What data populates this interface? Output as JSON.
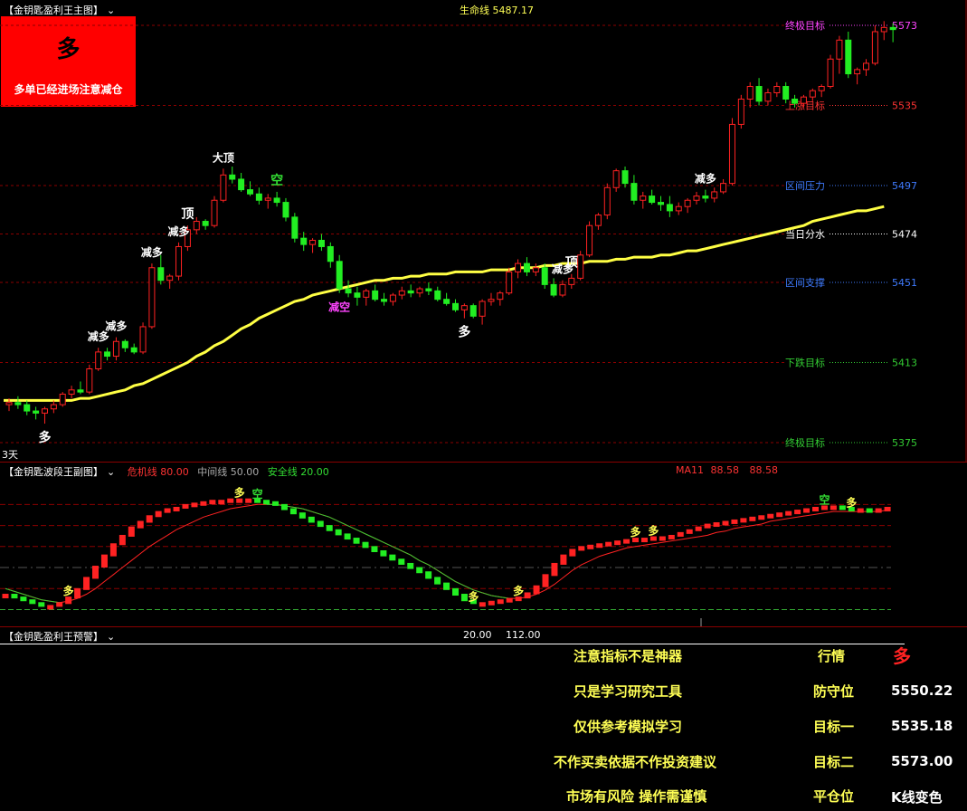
{
  "main": {
    "title": "【金钥匙盈利王主图】",
    "lifeline_label": "生命线",
    "lifeline_value": "5487.17",
    "signal_box": {
      "big": "多",
      "text": "多单已经进场注意减仓"
    },
    "period_label": "3天",
    "levels": [
      {
        "label": "终极目标",
        "value": "5573",
        "color": "#ff44ff",
        "level": 5573
      },
      {
        "label": "上涨目标",
        "value": "5535",
        "color": "#ff3333",
        "level": 5535
      },
      {
        "label": "区间压力",
        "value": "5497",
        "color": "#3f7bff",
        "level": 5497
      },
      {
        "label": "当日分水",
        "value": "5474",
        "color": "#ffffff",
        "level": 5474
      },
      {
        "label": "区间支撑",
        "value": "5451",
        "color": "#3f7bff",
        "level": 5451
      },
      {
        "label": "下跌目标",
        "value": "5413",
        "color": "#33cc33",
        "level": 5413
      },
      {
        "label": "终极目标",
        "value": "5375",
        "color": "#33cc33",
        "level": 5375
      }
    ],
    "markers": [
      {
        "text": "多",
        "i": 4,
        "pos": "below",
        "color": "#ffffff"
      },
      {
        "text": "减多",
        "i": 10,
        "pos": "above",
        "color": "#ffffff"
      },
      {
        "text": "减多",
        "i": 12,
        "pos": "above",
        "color": "#ffffff"
      },
      {
        "text": "减多",
        "i": 16,
        "pos": "above",
        "color": "#ffffff"
      },
      {
        "text": "减多",
        "i": 19,
        "pos": "above",
        "color": "#ffffff"
      },
      {
        "text": "顶",
        "i": 20,
        "pos": "above",
        "color": "#ffffff"
      },
      {
        "text": "大顶",
        "i": 24,
        "pos": "above",
        "color": "#ffffff"
      },
      {
        "text": "空",
        "i": 30,
        "pos": "above",
        "color": "#33dd33"
      },
      {
        "text": "减空",
        "i": 37,
        "pos": "below",
        "color": "#ff44ff"
      },
      {
        "text": "多",
        "i": 51,
        "pos": "below",
        "color": "#ffffff"
      },
      {
        "text": "减多",
        "i": 62,
        "pos": "above",
        "color": "#ffffff"
      },
      {
        "text": "顶",
        "i": 63,
        "pos": "above",
        "color": "#ffffff"
      },
      {
        "text": "减多",
        "i": 78,
        "pos": "above",
        "color": "#ffffff"
      }
    ]
  },
  "sub": {
    "title": "【金钥匙波段王副图】",
    "danger_label": "危机线",
    "danger_value": "80.00",
    "mid_label": "中间线",
    "mid_value": "50.00",
    "safe_label": "安全线",
    "safe_value": "20.00",
    "ma_label": "MA11",
    "ma_value1": "88.58",
    "ma_value2": "88.58",
    "markers": [
      {
        "text": "多",
        "i": 7,
        "color": "#ffff55"
      },
      {
        "text": "多",
        "i": 26,
        "color": "#ffff55"
      },
      {
        "text": "空",
        "i": 28,
        "color": "#33dd33"
      },
      {
        "text": "多",
        "i": 52,
        "color": "#ffff55"
      },
      {
        "text": "多",
        "i": 57,
        "color": "#ffff55"
      },
      {
        "text": "多",
        "i": 70,
        "color": "#ffff55"
      },
      {
        "text": "多",
        "i": 72,
        "color": "#ffff55"
      },
      {
        "text": "空",
        "i": 91,
        "color": "#33dd33"
      },
      {
        "text": "多",
        "i": 94,
        "color": "#ffff55"
      }
    ]
  },
  "warn": {
    "title": "【金钥匙盈利王预警】",
    "val1": "20.00",
    "val2": "112.00",
    "rows": [
      {
        "left": "注意指标不是神器",
        "key": "行情",
        "value": "多"
      },
      {
        "left": "只是学习研究工具",
        "key": "防守位",
        "value": "5550.22"
      },
      {
        "left": "仅供参考模拟学习",
        "key": "目标一",
        "value": "5535.18"
      },
      {
        "left": "不作买卖依据不作投资建议",
        "key": "目标二",
        "value": "5573.00"
      },
      {
        "left": "市场有风险 操作需谨慎",
        "key": "平仓位",
        "value": "K线变色"
      }
    ]
  },
  "colors": {
    "up": "#ff2222",
    "down": "#22ee22",
    "lifeline": "#ffff44",
    "bg": "#000000",
    "panel_border": "#8b0000"
  },
  "chart_data": {
    "type": "candlestick",
    "title": "金钥匙盈利王主图",
    "ylim": [
      5360,
      5585
    ],
    "candles": [
      [
        5393,
        5396,
        5390,
        5394
      ],
      [
        5394,
        5397,
        5391,
        5393
      ],
      [
        5393,
        5395,
        5388,
        5390
      ],
      [
        5390,
        5392,
        5386,
        5389
      ],
      [
        5389,
        5392,
        5384,
        5391
      ],
      [
        5391,
        5395,
        5389,
        5393
      ],
      [
        5393,
        5399,
        5392,
        5398
      ],
      [
        5398,
        5402,
        5396,
        5400
      ],
      [
        5400,
        5404,
        5398,
        5399
      ],
      [
        5399,
        5412,
        5398,
        5410
      ],
      [
        5410,
        5420,
        5409,
        5418
      ],
      [
        5418,
        5420,
        5414,
        5416
      ],
      [
        5416,
        5425,
        5414,
        5423
      ],
      [
        5423,
        5424,
        5418,
        5420
      ],
      [
        5420,
        5422,
        5417,
        5418
      ],
      [
        5418,
        5432,
        5417,
        5430
      ],
      [
        5430,
        5460,
        5429,
        5458
      ],
      [
        5458,
        5464,
        5450,
        5452
      ],
      [
        5452,
        5455,
        5448,
        5454
      ],
      [
        5454,
        5470,
        5452,
        5468
      ],
      [
        5468,
        5478,
        5466,
        5476
      ],
      [
        5476,
        5482,
        5474,
        5480
      ],
      [
        5480,
        5481,
        5476,
        5478
      ],
      [
        5478,
        5492,
        5477,
        5490
      ],
      [
        5490,
        5505,
        5489,
        5502
      ],
      [
        5502,
        5506,
        5498,
        5500
      ],
      [
        5500,
        5503,
        5494,
        5495
      ],
      [
        5495,
        5499,
        5492,
        5493
      ],
      [
        5493,
        5496,
        5488,
        5490
      ],
      [
        5490,
        5493,
        5486,
        5491
      ],
      [
        5491,
        5494,
        5487,
        5489
      ],
      [
        5489,
        5491,
        5480,
        5482
      ],
      [
        5482,
        5484,
        5470,
        5472
      ],
      [
        5472,
        5475,
        5466,
        5469
      ],
      [
        5469,
        5472,
        5465,
        5471
      ],
      [
        5471,
        5474,
        5466,
        5468
      ],
      [
        5468,
        5470,
        5458,
        5461
      ],
      [
        5461,
        5464,
        5446,
        5448
      ],
      [
        5448,
        5452,
        5444,
        5446
      ],
      [
        5446,
        5449,
        5440,
        5444
      ],
      [
        5444,
        5448,
        5440,
        5447
      ],
      [
        5447,
        5450,
        5442,
        5443
      ],
      [
        5443,
        5446,
        5440,
        5442
      ],
      [
        5442,
        5446,
        5440,
        5445
      ],
      [
        5445,
        5449,
        5443,
        5447
      ],
      [
        5447,
        5450,
        5444,
        5446
      ],
      [
        5446,
        5449,
        5444,
        5448
      ],
      [
        5448,
        5451,
        5445,
        5447
      ],
      [
        5447,
        5449,
        5442,
        5443
      ],
      [
        5443,
        5446,
        5440,
        5441
      ],
      [
        5441,
        5443,
        5437,
        5438
      ],
      [
        5438,
        5441,
        5434,
        5440
      ],
      [
        5440,
        5441,
        5434,
        5435
      ],
      [
        5435,
        5443,
        5431,
        5442
      ],
      [
        5442,
        5446,
        5440,
        5443
      ],
      [
        5443,
        5447,
        5440,
        5446
      ],
      [
        5446,
        5458,
        5445,
        5456
      ],
      [
        5456,
        5462,
        5453,
        5460
      ],
      [
        5460,
        5463,
        5454,
        5456
      ],
      [
        5456,
        5460,
        5454,
        5458
      ],
      [
        5458,
        5460,
        5448,
        5450
      ],
      [
        5450,
        5453,
        5444,
        5445
      ],
      [
        5445,
        5452,
        5444,
        5450
      ],
      [
        5450,
        5455,
        5448,
        5453
      ],
      [
        5453,
        5466,
        5452,
        5464
      ],
      [
        5464,
        5480,
        5463,
        5478
      ],
      [
        5478,
        5484,
        5476,
        5483
      ],
      [
        5483,
        5498,
        5481,
        5496
      ],
      [
        5496,
        5505,
        5494,
        5504
      ],
      [
        5504,
        5506,
        5496,
        5498
      ],
      [
        5498,
        5502,
        5488,
        5490
      ],
      [
        5490,
        5494,
        5486,
        5492
      ],
      [
        5492,
        5495,
        5488,
        5489
      ],
      [
        5489,
        5492,
        5485,
        5488
      ],
      [
        5488,
        5492,
        5482,
        5485
      ],
      [
        5485,
        5489,
        5483,
        5487
      ],
      [
        5487,
        5491,
        5484,
        5490
      ],
      [
        5490,
        5494,
        5488,
        5492
      ],
      [
        5492,
        5495,
        5489,
        5491
      ],
      [
        5491,
        5496,
        5489,
        5494
      ],
      [
        5494,
        5500,
        5493,
        5498
      ],
      [
        5498,
        5529,
        5497,
        5526
      ],
      [
        5526,
        5540,
        5524,
        5538
      ],
      [
        5538,
        5546,
        5534,
        5544
      ],
      [
        5544,
        5548,
        5535,
        5537
      ],
      [
        5537,
        5543,
        5535,
        5541
      ],
      [
        5541,
        5546,
        5539,
        5544
      ],
      [
        5544,
        5546,
        5536,
        5538
      ],
      [
        5538,
        5540,
        5534,
        5536
      ],
      [
        5536,
        5540,
        5534,
        5539
      ],
      [
        5539,
        5543,
        5537,
        5542
      ],
      [
        5542,
        5545,
        5539,
        5544
      ],
      [
        5544,
        5559,
        5543,
        5557
      ],
      [
        5557,
        5568,
        5550,
        5566
      ],
      [
        5566,
        5570,
        5548,
        5550
      ],
      [
        5550,
        5553,
        5545,
        5552
      ],
      [
        5552,
        5557,
        5549,
        5555
      ],
      [
        5555,
        5573,
        5554,
        5570
      ],
      [
        5570,
        5575,
        5566,
        5572
      ],
      [
        5572,
        5574,
        5565,
        5571
      ]
    ],
    "lifeline": [
      5395,
      5395,
      5395,
      5395,
      5395,
      5395,
      5395,
      5395,
      5396,
      5396,
      5397,
      5398,
      5399,
      5400,
      5402,
      5403,
      5405,
      5407,
      5409,
      5411,
      5413,
      5416,
      5418,
      5421,
      5423,
      5426,
      5429,
      5431,
      5434,
      5436,
      5438,
      5440,
      5442,
      5443,
      5445,
      5446,
      5447,
      5448,
      5449,
      5450,
      5451,
      5452,
      5452,
      5453,
      5453,
      5454,
      5454,
      5455,
      5455,
      5455,
      5456,
      5456,
      5456,
      5456,
      5457,
      5457,
      5457,
      5458,
      5458,
      5458,
      5459,
      5459,
      5460,
      5460,
      5460,
      5461,
      5461,
      5461,
      5462,
      5462,
      5463,
      5463,
      5463,
      5464,
      5464,
      5465,
      5466,
      5466,
      5467,
      5468,
      5469,
      5470,
      5471,
      5472,
      5473,
      5474,
      5475,
      5476,
      5477,
      5478,
      5480,
      5481,
      5482,
      5483,
      5484,
      5485,
      5485,
      5486,
      5487
    ]
  },
  "wave_data": {
    "type": "bar",
    "title": "金钥匙波段王副图",
    "ylim": [
      10,
      112
    ],
    "values": [
      30,
      28,
      26,
      24,
      22,
      22,
      24,
      28,
      34,
      42,
      50,
      58,
      66,
      72,
      78,
      82,
      86,
      89,
      91,
      92,
      94,
      95,
      96,
      97,
      97,
      98,
      98,
      98,
      97,
      96,
      94,
      91,
      88,
      85,
      82,
      79,
      76,
      73,
      70,
      67,
      64,
      61,
      58,
      55,
      52,
      49,
      46,
      42,
      38,
      34,
      30,
      26,
      24,
      24,
      25,
      26,
      27,
      28,
      31,
      36,
      44,
      52,
      58,
      62,
      64,
      65,
      66,
      67,
      68,
      69,
      70,
      70,
      71,
      71,
      72,
      74,
      76,
      78,
      80,
      81,
      82,
      83,
      84,
      85,
      86,
      87,
      88,
      89,
      90,
      91,
      92,
      93,
      93,
      92,
      91,
      91,
      90,
      91,
      92
    ],
    "ma": [
      35,
      33,
      31,
      29,
      27,
      26,
      25,
      26,
      28,
      31,
      35,
      40,
      45,
      50,
      55,
      60,
      65,
      69,
      73,
      77,
      80,
      83,
      86,
      88,
      90,
      92,
      93,
      94,
      95,
      95,
      95,
      94,
      93,
      92,
      90,
      88,
      86,
      83,
      80,
      77,
      74,
      71,
      68,
      65,
      62,
      59,
      55,
      52,
      48,
      44,
      40,
      37,
      34,
      32,
      30,
      29,
      28,
      28,
      29,
      31,
      34,
      38,
      43,
      48,
      52,
      55,
      58,
      60,
      62,
      64,
      65,
      66,
      67,
      68,
      69,
      70,
      71,
      72,
      73,
      75,
      76,
      78,
      79,
      80,
      81,
      83,
      84,
      85,
      86,
      87,
      88,
      89,
      90,
      90,
      90,
      90,
      90,
      90,
      91
    ],
    "levels": [
      {
        "name": "危机线",
        "value": 80
      },
      {
        "name": "中间线",
        "value": 50
      },
      {
        "name": "安全线",
        "value": 20
      }
    ]
  }
}
